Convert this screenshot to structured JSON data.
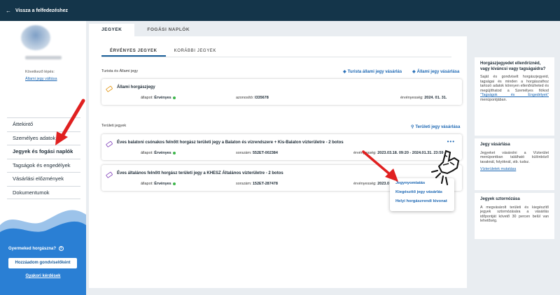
{
  "topbar": {
    "back_label": "Vissza a felfedezéshez"
  },
  "sidebar": {
    "next_step_label": "Következő lépés:",
    "next_step_link": "Állami jegy váltása",
    "nav": [
      {
        "label": "Áttekintő"
      },
      {
        "label": "Személyes adatok"
      },
      {
        "label": "Jegyek és fogási naplók",
        "active": true
      },
      {
        "label": "Tagságok és engedélyek"
      },
      {
        "label": "Vásárlási előzmények"
      },
      {
        "label": "Dokumentumok"
      }
    ],
    "child_question": "Gyermeked horgászna?",
    "add_guardian_button": "Hozzáadom gondviselőként",
    "faq_link": "Gyakori kérdések"
  },
  "tabs": [
    {
      "label": "JEGYEK",
      "active": true
    },
    {
      "label": "FOGÁSI NAPLÓK",
      "active": false
    }
  ],
  "subtabs": [
    {
      "label": "ÉRVÉNYES JEGYEK",
      "active": true
    },
    {
      "label": "KORÁBBI JEGYEK",
      "active": false
    }
  ],
  "state_section": {
    "title": "Turista és Állami jegy",
    "link1": "Turista állami jegy vásárlás",
    "link2": "Állami jegy vásárlása",
    "card": {
      "name": "Állami horgászjegy",
      "status_label": "állapot:",
      "status_value": "Érvényes",
      "id_label": "azonosító:",
      "id_value": "I335678",
      "validity_label": "érvényesség:",
      "validity_value": "2024. 01. 31."
    }
  },
  "area_section": {
    "title": "Területi jegyek",
    "link": "Területi jegy vásárlása",
    "cards": [
      {
        "name": "Éves balatoni csónakos felnőtt horgász területi jegy a Balaton és vízrendszere + Kis-Balaton vízterületre - 2 botos",
        "status_label": "állapot:",
        "status_value": "Érvényes",
        "serial_label": "sorszám:",
        "serial_value": "552ET-002384",
        "validity_label": "érvényesség:",
        "validity_value": "2023.03.18. 09:20 - 2024.01.31. 23:59"
      },
      {
        "name": "Éves általános felnőtt horgász területi jegy a KHESZ Általános vízterületre - 2 botos",
        "status_label": "állapot:",
        "status_value": "Érvényes",
        "serial_label": "sorszám:",
        "serial_value": "152ET-287478",
        "validity_label": "érvényesség:",
        "validity_value": "2023.0"
      }
    ]
  },
  "dropdown": {
    "items": [
      "Jegynyomtatás",
      "Kiegészítő jegy vásárlás",
      "Helyi horgászrendi kivonat"
    ]
  },
  "right_panel": {
    "box1": {
      "title": "Horgászjegyedet ellenőriznéd, vagy kíváncsi vagy tagságaidra?",
      "text": "Saját és gondviselt horgászjegyeid, tagságai és minden a horgászathoz tartozó adatok könnyen ellenőrizheted és megújíthatod a Személyes fiókod",
      "link": "\"Tagságok és Engedélyek\"",
      "text2": "menüpontjában."
    },
    "box2": {
      "title": "Jegy vásárlása",
      "text": "Jegyeket vásárolni a Vízterület menüpontban található különböző tavaknál, folyóknál, stb. tudsz.",
      "link": "Vízterületek mutatása"
    },
    "box3": {
      "title": "Jegyek sztornózása",
      "text": "A megvásárolt területi és kiegészítő jegyek sztornózására a vásárlás időpontját követő 30 percen belül van lehetőség."
    }
  },
  "colors": {
    "accent": "#1c67b3",
    "topbar": "#14354a",
    "valid": "#3cb64a",
    "annotation": "#e02020"
  }
}
